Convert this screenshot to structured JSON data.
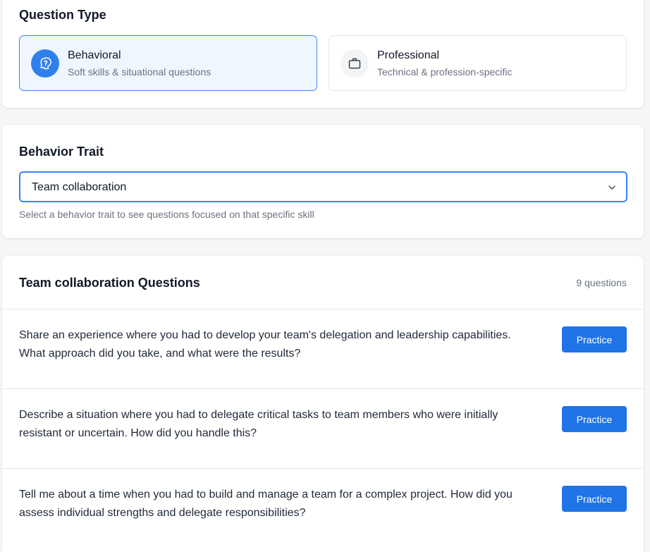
{
  "question_type": {
    "title": "Question Type",
    "options": [
      {
        "label": "Behavioral",
        "description": "Soft skills & situational questions",
        "icon": "head-lightbulb-icon",
        "selected": true
      },
      {
        "label": "Professional",
        "description": "Technical & profession-specific",
        "icon": "briefcase-icon",
        "selected": false
      }
    ]
  },
  "behavior_trait": {
    "title": "Behavior Trait",
    "selected_value": "Team collaboration",
    "hint": "Select a behavior trait to see questions focused on that specific skill"
  },
  "questions": {
    "title": "Team collaboration Questions",
    "count_label": "9 questions",
    "practice_label": "Practice",
    "items": [
      {
        "text": "Share an experience where you had to develop your team's delegation and leadership capabilities. What approach did you take, and what were the results?"
      },
      {
        "text": "Describe a situation where you had to delegate critical tasks to team members who were initially resistant or uncertain. How did you handle this?"
      },
      {
        "text": "Tell me about a time when you had to build and manage a team for a complex project. How did you assess individual strengths and delegate responsibilities?"
      }
    ]
  },
  "colors": {
    "accent": "#1f74e8",
    "selected_bg": "#eff6ff",
    "selected_border": "#3b82f6"
  }
}
